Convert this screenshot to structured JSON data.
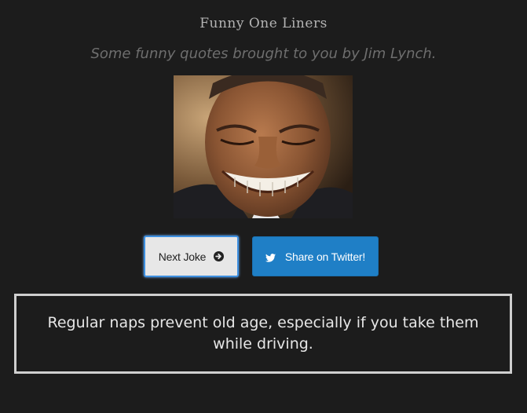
{
  "header": {
    "title": "Funny One Liners",
    "subtitle": "Some funny quotes brought to you by Jim Lynch."
  },
  "photo": {
    "icon": "laughing-face-photo"
  },
  "actions": {
    "next_label": "Next Joke",
    "next_icon": "arrow-circle-right-icon",
    "share_label": "Share on Twitter!",
    "share_icon": "twitter-icon"
  },
  "quote": {
    "text": "Regular naps prevent old age, especially if you take them while driving."
  },
  "colors": {
    "background": "#1c1c1c",
    "twitter_button": "#1f7fc6",
    "focus_ring": "#3d8fe0",
    "quote_border": "#cfcfcf"
  }
}
